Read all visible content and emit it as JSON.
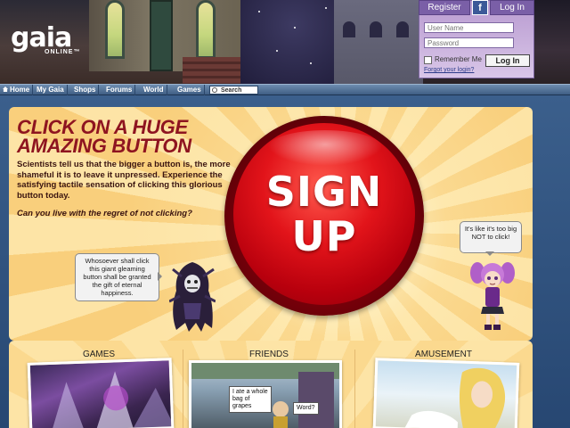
{
  "header": {
    "logo_main": "gaia",
    "logo_sub": "ONLINE™"
  },
  "login": {
    "register_tab": "Register",
    "facebook_glyph": "f",
    "login_tab": "Log In",
    "username_placeholder": "User Name",
    "password_placeholder": "Password",
    "remember_label": "Remember Me",
    "forgot_link": "Forgot your login?",
    "submit_label": "Log In"
  },
  "nav": {
    "items": [
      "Home",
      "My Gaia",
      "Shops",
      "Forums",
      "World",
      "Games"
    ],
    "search_label": "Search"
  },
  "promo": {
    "headline_line1": "CLICK ON A HUGE",
    "headline_line2": "AMAZING BUTTON",
    "description": "Scientists tell us that the bigger a button is, the more shameful it is to leave it unpressed. Experience the satisfying tactile sensation of clicking this glorious button today.",
    "question": "Can you live with the regret of not clicking?",
    "signup_line1": "SIGN",
    "signup_line2": "UP",
    "bubble_left": "Whosoever shall click this giant gleaming button shall be granted the gift of eternal happiness.",
    "bubble_right": "It's like it's too big NOT to click!"
  },
  "sections": {
    "games_title": "GAMES",
    "friends_title": "FRIENDS",
    "amusement_title": "AMUSEMENT",
    "friends_bubble1": "I ate a whole bag of grapes",
    "friends_bubble2": "Word?"
  },
  "colors": {
    "headline": "#8e1420",
    "signup_red": "#e2141a",
    "login_panel": "#d9c6e8",
    "nav_blue": "#3f5e84"
  }
}
